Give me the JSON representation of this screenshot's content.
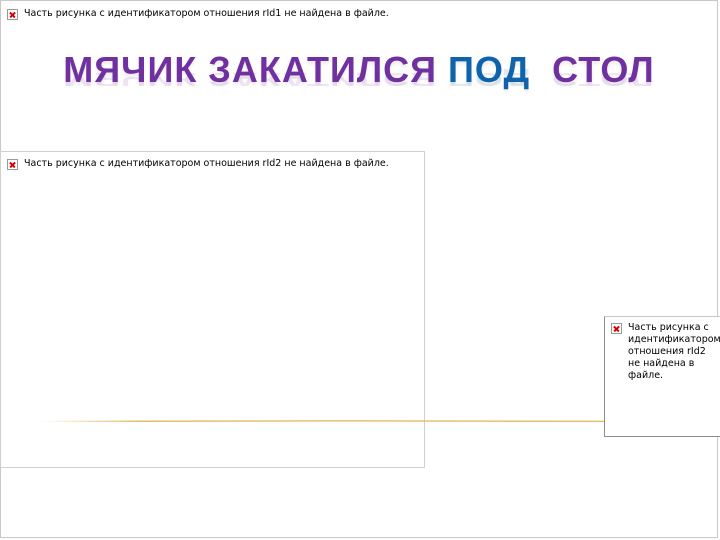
{
  "slide": {
    "title": {
      "word1": "МЯЧИК ЗАКАТИЛСЯ",
      "word2": "ПОД",
      "word3": "СТОЛ"
    },
    "placeholders": {
      "top_message": "Часть рисунка с идентификатором отношения rId1 не найдена в файле.",
      "mid_message": "Часть рисунка с идентификатором отношения rId2 не найдена в файле.",
      "right_message": "Часть рисунка с идентификатором отношения rId2 не найдена в файле."
    },
    "colors": {
      "title_purple": "#7030a0",
      "title_blue": "#0e63ac",
      "line_gold": "#e0b45a"
    }
  }
}
